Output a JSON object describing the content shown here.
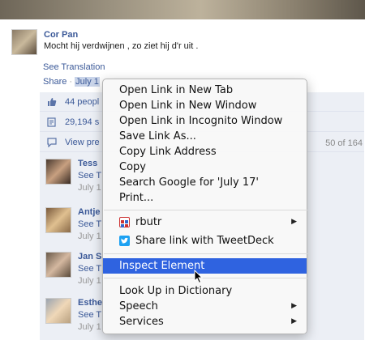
{
  "post": {
    "author": "Cor Pan",
    "text": "Mocht hij verdwijnen , zo ziet hij d'r uit .",
    "see_translation": "See Translation",
    "share_label": "Share",
    "separator": "·",
    "date_link": "July 1"
  },
  "feedback": {
    "likes": "44 peopl",
    "shares": "29,194 s",
    "view_previous": "View pre",
    "count": "50 of 164"
  },
  "comments": [
    {
      "name": "Tess",
      "line": "See T",
      "date": "July 1"
    },
    {
      "name": "Antje",
      "line": "See T",
      "date": "July 1"
    },
    {
      "name": "Jan S",
      "line": "See T",
      "date": "July 1"
    },
    {
      "name": "Esthe",
      "line": "See T",
      "date": "July 1"
    }
  ],
  "context_menu": {
    "items": [
      {
        "label": "Open Link in New Tab"
      },
      {
        "label": "Open Link in New Window"
      },
      {
        "label": "Open Link in Incognito Window"
      },
      {
        "label": "Save Link As..."
      },
      {
        "label": "Copy Link Address"
      },
      {
        "label": "Copy"
      },
      {
        "label": "Search Google for 'July 17'"
      },
      {
        "label": "Print..."
      },
      {
        "label": "rbutr",
        "icon": "rbutr-icon",
        "has_submenu": true
      },
      {
        "label": "Share link with TweetDeck",
        "icon": "tweetdeck-icon"
      },
      {
        "label": "Inspect Element",
        "highlighted": true
      },
      {
        "label": "Look Up in Dictionary"
      },
      {
        "label": "Speech",
        "has_submenu": true
      },
      {
        "label": "Services",
        "has_submenu": true
      }
    ],
    "submenu_arrow": "▶"
  },
  "colors": {
    "link": "#3b5998",
    "highlight": "#2f63e0",
    "feedback_bg": "#eceff5"
  }
}
